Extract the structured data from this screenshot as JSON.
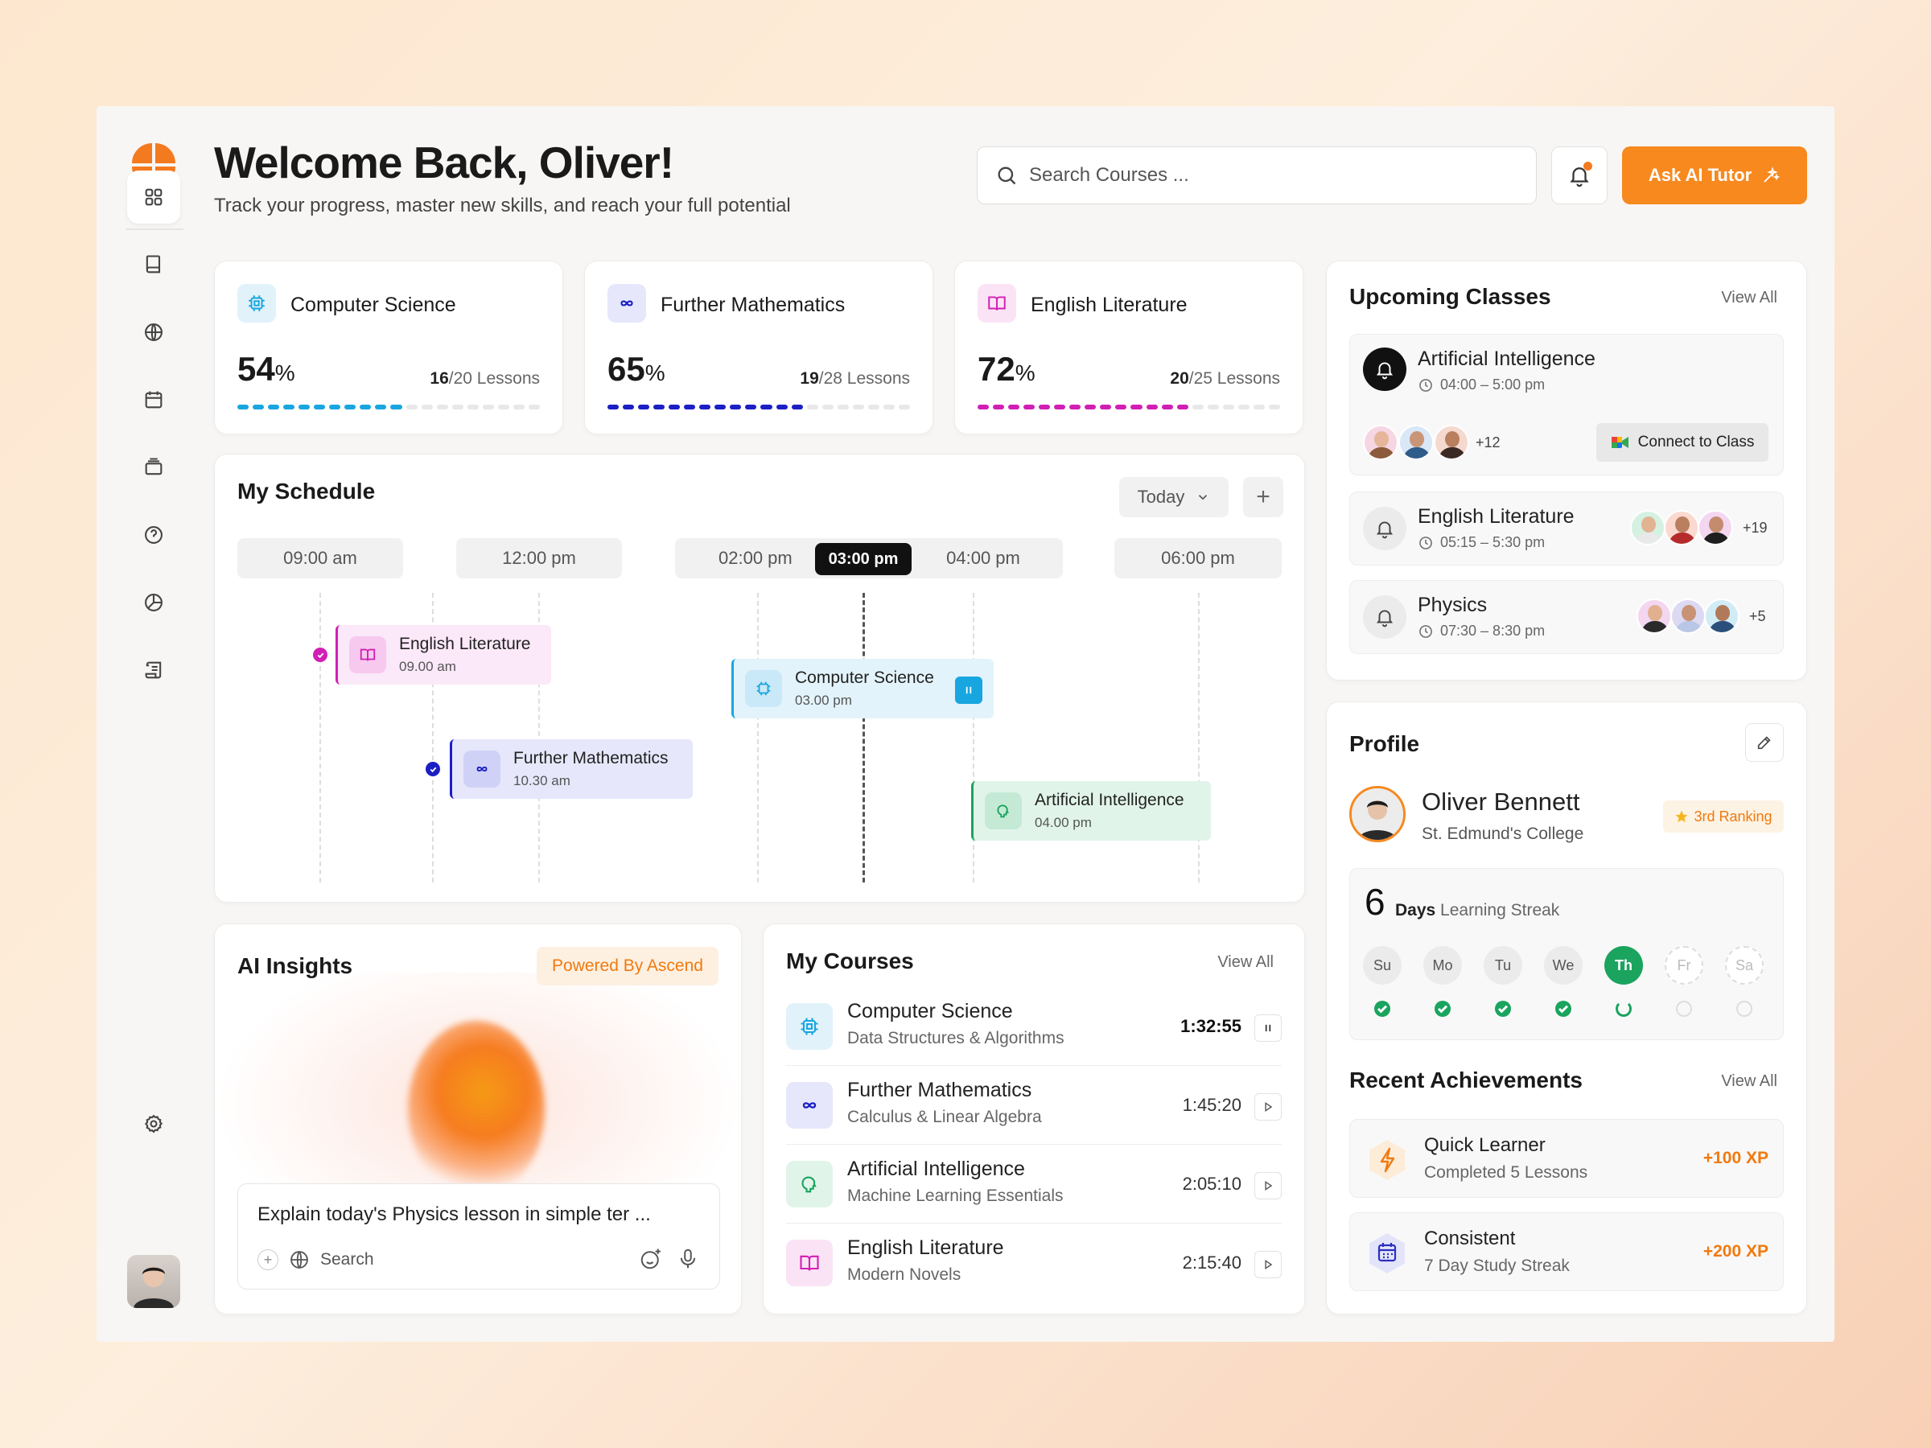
{
  "header": {
    "title": "Welcome Back, Oliver!",
    "subtitle": "Track your progress, master new skills, and reach your full potential",
    "search_placeholder": "Search Courses ...",
    "ai_button": "Ask AI Tutor"
  },
  "sidebar": {
    "items": [
      {
        "icon": "grid-icon",
        "active": true
      },
      {
        "icon": "book-icon"
      },
      {
        "icon": "globe-icon"
      },
      {
        "icon": "calendar-icon"
      },
      {
        "icon": "cards-icon"
      },
      {
        "icon": "help-icon"
      },
      {
        "icon": "chart-icon"
      },
      {
        "icon": "certificate-icon"
      }
    ],
    "settings_icon": "gear-icon"
  },
  "stats": [
    {
      "name": "Computer Science",
      "percent": "54",
      "unit": "%",
      "done": "16",
      "total": "/20 Lessons",
      "progress": 0.54,
      "color": "#18a6e0"
    },
    {
      "name": "Further Mathematics",
      "percent": "65",
      "unit": "%",
      "done": "19",
      "total": "/28 Lessons",
      "progress": 0.65,
      "color": "#1b1fc4"
    },
    {
      "name": "English Literature",
      "percent": "72",
      "unit": "%",
      "done": "20",
      "total": "/25 Lessons",
      "progress": 0.72,
      "color": "#d11fb5"
    }
  ],
  "schedule": {
    "title": "My Schedule",
    "filter": "Today",
    "times": [
      "09:00 am",
      "12:00 pm",
      "02:00 pm",
      "04:00 pm",
      "06:00 pm"
    ],
    "now": "03:00 pm",
    "events": [
      {
        "name": "English Literature",
        "time": "09.00 am"
      },
      {
        "name": "Computer Science",
        "time": "03.00 pm"
      },
      {
        "name": "Further Mathematics",
        "time": "10.30 am"
      },
      {
        "name": "Artificial Intelligence",
        "time": "04.00 pm"
      }
    ]
  },
  "ai_insights": {
    "title": "AI Insights",
    "badge": "Powered By Ascend",
    "prompt": "Explain today's Physics lesson in simple ter ...",
    "search": "Search"
  },
  "my_courses": {
    "title": "My Courses",
    "view_all": "View All",
    "items": [
      {
        "name": "Computer Science",
        "sub": "Data Structures & Algorithms",
        "time": "1:32:55",
        "state": "pause"
      },
      {
        "name": "Further Mathematics",
        "sub": "Calculus & Linear Algebra",
        "time": "1:45:20",
        "state": "play"
      },
      {
        "name": "Artificial Intelligence",
        "sub": "Machine Learning Essentials",
        "time": "2:05:10",
        "state": "play"
      },
      {
        "name": "English Literature",
        "sub": "Modern Novels",
        "time": "2:15:40",
        "state": "play"
      }
    ]
  },
  "upcoming": {
    "title": "Upcoming Classes",
    "view_all": "View All",
    "classes": [
      {
        "name": "Artificial Intelligence",
        "time": "04:00 – 5:00 pm",
        "more": "+12",
        "button": "Connect to Class"
      },
      {
        "name": "English Literature",
        "time": "05:15 – 5:30 pm",
        "more": "+19"
      },
      {
        "name": "Physics",
        "time": "07:30 – 8:30 pm",
        "more": "+5"
      }
    ]
  },
  "profile": {
    "title": "Profile",
    "name": "Oliver Bennett",
    "college": "St. Edmund's College",
    "ranking": "3rd Ranking",
    "streak_number": "6",
    "streak_days": "Days",
    "streak_label": "Learning Streak",
    "days": [
      "Su",
      "Mo",
      "Tu",
      "We",
      "Th",
      "Fr",
      "Sa"
    ]
  },
  "achievements": {
    "title": "Recent Achievements",
    "view_all": "View All",
    "items": [
      {
        "name": "Quick Learner",
        "sub": "Completed 5 Lessons",
        "xp": "+100 XP"
      },
      {
        "name": "Consistent",
        "sub": "7 Day Study Streak",
        "xp": "+200 XP"
      }
    ]
  }
}
